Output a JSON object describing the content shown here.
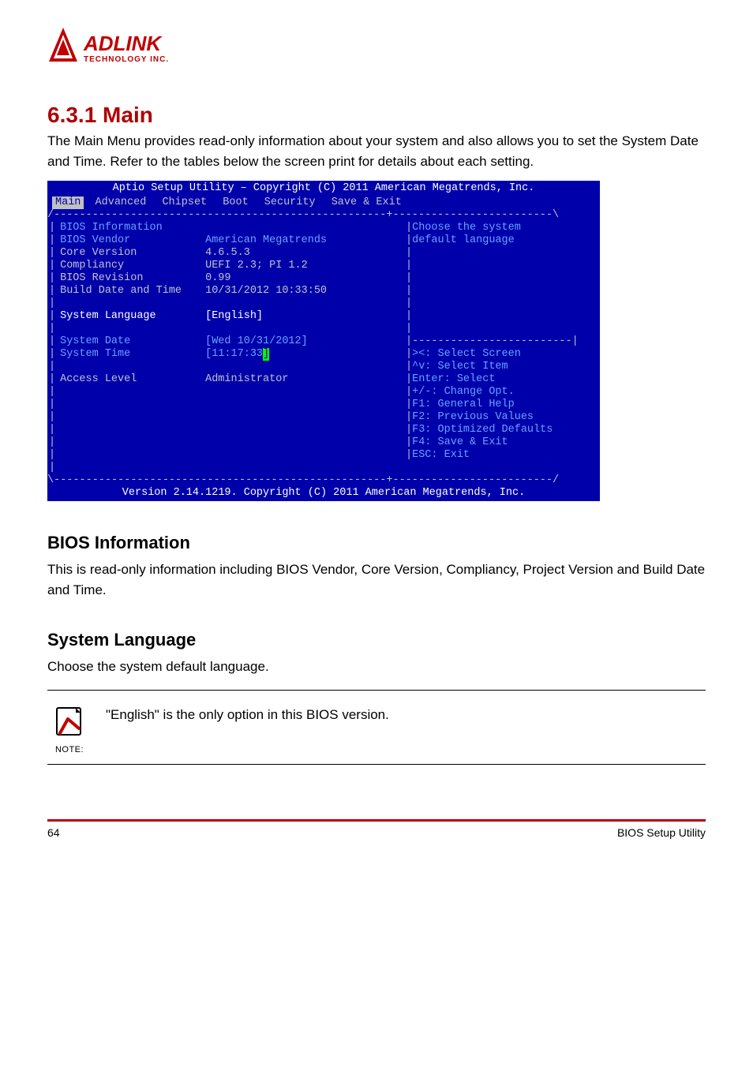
{
  "logo": {
    "brand_top": "ADLINK",
    "brand_bottom": "TECHNOLOGY INC."
  },
  "section": {
    "number": "6.3.1 Main",
    "intro": "The Main Menu provides read-only information about your system and also allows you to set the System Date and Time. Refer to the tables below the screen print for details about each setting."
  },
  "bios": {
    "header": "Aptio Setup Utility – Copyright (C) 2011 American Megatrends, Inc.",
    "tabs": {
      "active": "Main",
      "others": [
        "Advanced",
        "Chipset",
        "Boot",
        "Security",
        "Save & Exit"
      ]
    },
    "top_border": "/----------------------------------------------------+-------------------------\\",
    "mid_border": "\\----------------------------------------------------+-------------------------/",
    "side_divider": "|-------------------------|",
    "pipe": "|",
    "info_title": "BIOS Information",
    "rows": {
      "vendor_lbl": "BIOS Vendor",
      "vendor_val": "American Megatrends",
      "core_lbl": "Core Version",
      "core_val": "4.6.5.3",
      "comp_lbl": "Compliancy",
      "comp_val": "UEFI 2.3; PI 1.2",
      "rev_lbl": "BIOS Revision",
      "rev_val": "0.99",
      "bd_lbl": "Build Date and Time",
      "bd_val": "10/31/2012 10:33:50",
      "lang_lbl": "System Language",
      "lang_val": "[English]",
      "date_lbl": "System Date",
      "date_val": "[Wed 10/31/2012]",
      "time_lbl": "System Time",
      "time_val": "[11:17:33",
      "time_close": "]",
      "acc_lbl": "Access Level",
      "acc_val": "Administrator"
    },
    "help": {
      "l1": "Choose the system",
      "l2": "default language",
      "k1": "><: Select Screen",
      "k2": "^v: Select Item",
      "k3": "Enter: Select",
      "k4": "+/-: Change Opt.",
      "k5": "F1: General Help",
      "k6": "F2: Previous Values",
      "k7": "F3: Optimized Defaults",
      "k8": "F4: Save & Exit",
      "k9": "ESC: Exit"
    },
    "footer": "Version 2.14.1219. Copyright (C) 2011 American Megatrends, Inc."
  },
  "info_heading": "BIOS Information",
  "info_para": "This is read-only information including BIOS Vendor, Core Version, Compliancy, Project Version and Build Date and Time.",
  "lang_heading": "System Language",
  "lang_para": "Choose the system default language.",
  "note": {
    "label": "NOTE:",
    "text": "\"English\" is the only option in this BIOS version."
  },
  "foot_left": "64",
  "foot_right": "BIOS Setup Utility"
}
